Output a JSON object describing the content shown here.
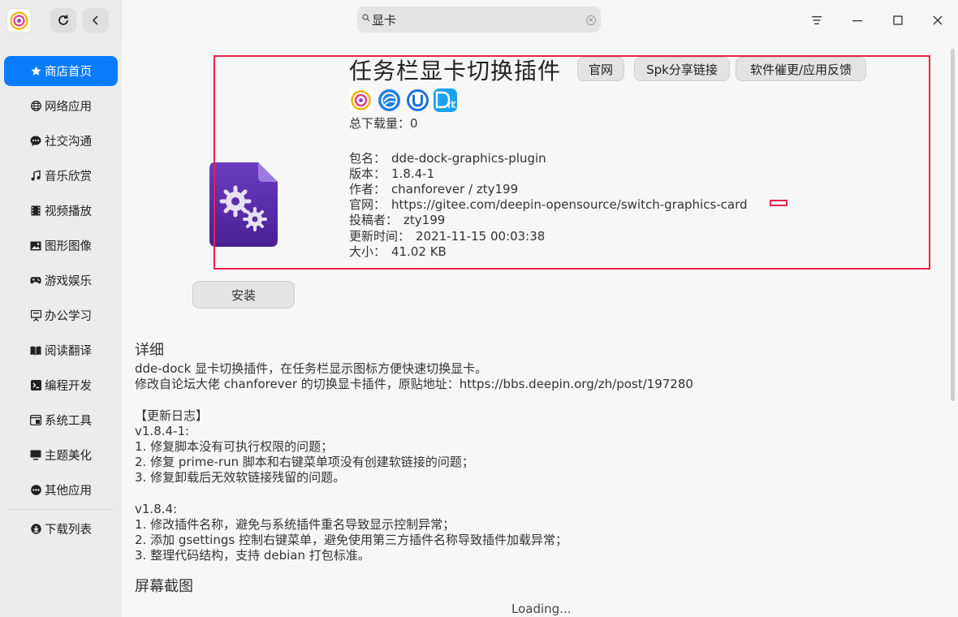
{
  "window": {
    "search": {
      "value": "显卡",
      "clear_glyph": "×"
    },
    "icons": [
      "app-logo",
      "refresh-icon",
      "back-icon",
      "menu-icon",
      "minimize-icon",
      "maximize-icon",
      "close-icon"
    ]
  },
  "sidebar": {
    "items": [
      {
        "label": "商店首页",
        "icon": "star-icon",
        "active": true
      },
      {
        "label": "网络应用",
        "icon": "globe-icon"
      },
      {
        "label": "社交沟通",
        "icon": "chat-icon"
      },
      {
        "label": "音乐欣赏",
        "icon": "music-icon"
      },
      {
        "label": "视频播放",
        "icon": "film-icon"
      },
      {
        "label": "图形图像",
        "icon": "image-icon"
      },
      {
        "label": "游戏娱乐",
        "icon": "gamepad-icon"
      },
      {
        "label": "办公学习",
        "icon": "presentation-icon"
      },
      {
        "label": "阅读翻译",
        "icon": "book-icon"
      },
      {
        "label": "编程开发",
        "icon": "terminal-icon"
      },
      {
        "label": "系统工具",
        "icon": "tool-icon"
      },
      {
        "label": "主题美化",
        "icon": "monitor-icon"
      },
      {
        "label": "其他应用",
        "icon": "more-icon"
      }
    ],
    "download": {
      "label": "下载列表",
      "icon": "download-icon"
    }
  },
  "app": {
    "title": "任务栏显卡切换插件",
    "buttons": {
      "website": "官网",
      "share": "Spk分享链接",
      "feedback": "软件催更/应用反馈"
    },
    "badges": [
      "spark-badge",
      "deepin-badge",
      "uos-badge",
      "dtk-badge"
    ],
    "downloads": "总下载量：0",
    "info": [
      {
        "k": "包名：",
        "v": "dde-dock-graphics-plugin"
      },
      {
        "k": "版本：",
        "v": "1.8.4-1"
      },
      {
        "k": "作者：",
        "v": "chanforever / zty199"
      },
      {
        "k": "官网：",
        "v": "https://gitee.com/deepin-opensource/switch-graphics-card"
      },
      {
        "k": "投稿者：",
        "v": "zty199"
      },
      {
        "k": "更新时间：",
        "v": "2021-11-15 00:03:38"
      },
      {
        "k": "大小：",
        "v": "41.02 KB"
      }
    ],
    "install_label": "安装"
  },
  "details": {
    "title": "详细",
    "lines": [
      "dde-dock 显卡切换插件，在任务栏显示图标方便快速切换显卡。",
      "修改自论坛大佬 chanforever 的切换显卡插件，原贴地址：https://bbs.deepin.org/zh/post/197280",
      "",
      "【更新日志】",
      "v1.8.4-1:",
      "1. 修复脚本没有可执行权限的问题；",
      "2. 修复 prime-run 脚本和右键菜单项没有创建软链接的问题；",
      "3. 修复卸载后无效软链接残留的问题。",
      "",
      "v1.8.4:",
      "1. 修改插件名称，避免与系统插件重名导致显示控制异常；",
      "2. 添加 gsettings 控制右键菜单，避免使用第三方插件名称导致插件加载异常；",
      "3. 整理代码结构，支持 debian 打包标准。"
    ]
  },
  "screenshots": {
    "title": "屏幕截图",
    "loading": "Loading..."
  },
  "colors": {
    "accent": "#0a7dff",
    "highlight": "#e8204a",
    "app_icon": "#5a2ea6"
  }
}
